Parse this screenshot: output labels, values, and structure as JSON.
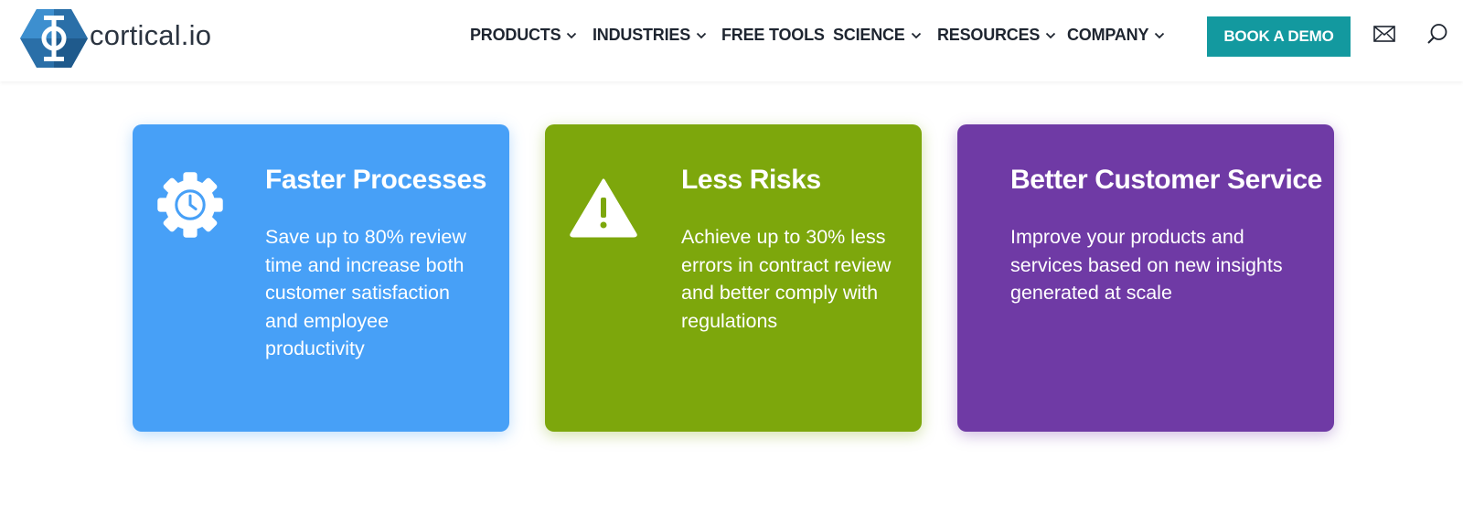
{
  "brand": {
    "name": "cortical.io",
    "accent_color": "#13999f",
    "logo_icon": "hexagon-logo-icon"
  },
  "nav": {
    "items": [
      {
        "label": "PRODUCTS",
        "has_dropdown": true
      },
      {
        "label": "INDUSTRIES",
        "has_dropdown": true
      },
      {
        "label": "FREE TOOLS",
        "has_dropdown": false
      },
      {
        "label": "SCIENCE",
        "has_dropdown": true
      },
      {
        "label": "RESOURCES",
        "has_dropdown": true
      },
      {
        "label": "COMPANY",
        "has_dropdown": true
      }
    ],
    "cta_label": "BOOK A DEMO",
    "icons": [
      "mail-icon",
      "search-icon"
    ]
  },
  "cards": [
    {
      "title": "Faster Processes",
      "text": "Save up to 80% review time and increase both customer satisfaction and employee productivity",
      "icon": "gear-clock-icon",
      "color": "#47a0f7"
    },
    {
      "title": "Less Risks",
      "text": "Achieve up to 30% less errors in contract review and better comply with regulations",
      "icon": "warning-icon",
      "color": "#7da70c"
    },
    {
      "title": "Better Customer Service",
      "text": "Improve your products and services based on new insights generated at scale",
      "icon": "",
      "color": "#6f3aa5"
    }
  ]
}
